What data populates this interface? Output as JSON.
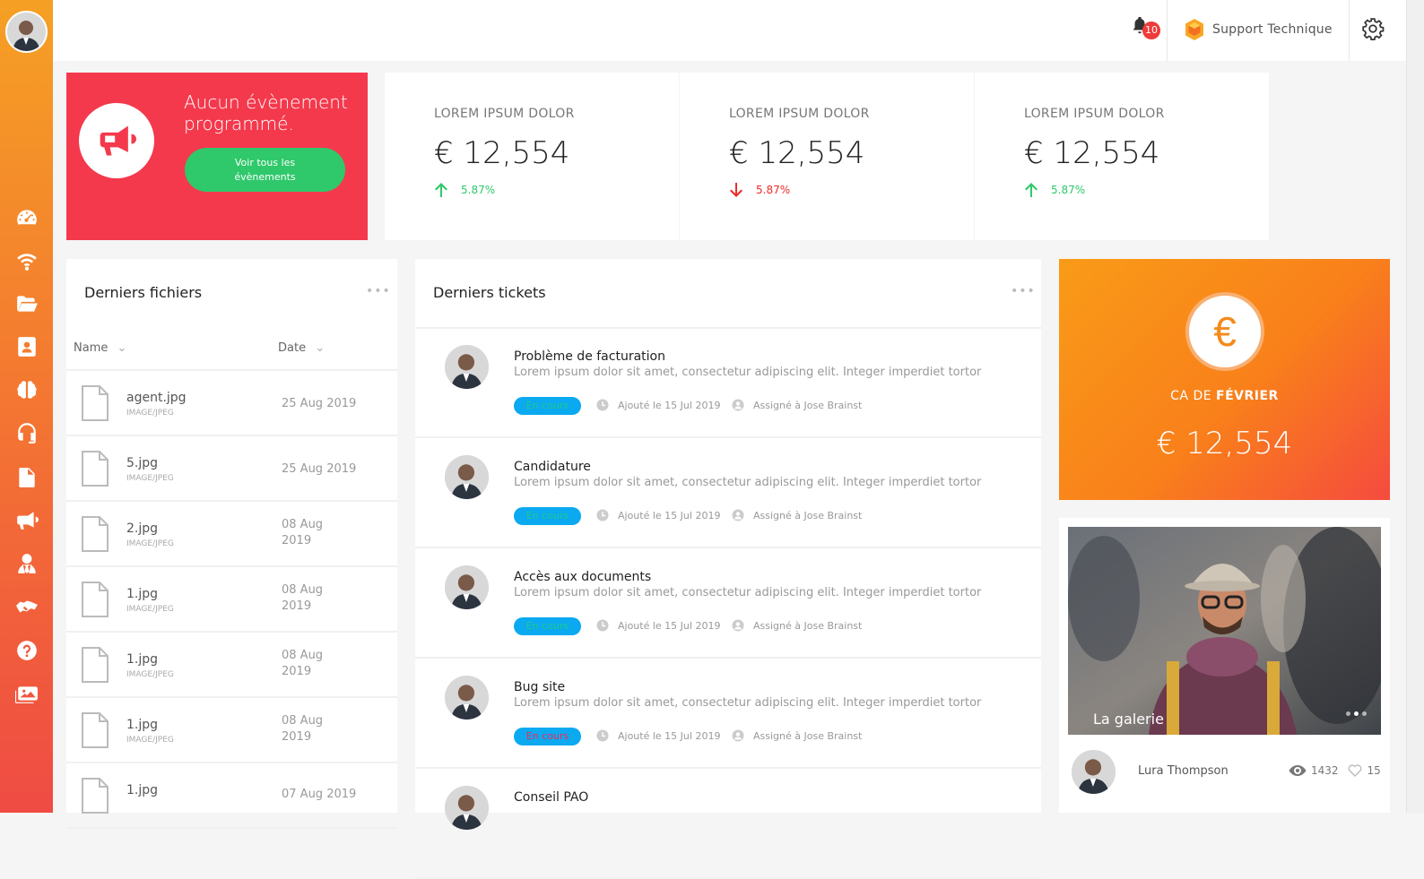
{
  "topbar": {
    "notifications_count": "10",
    "support_label": "Support Technique"
  },
  "event_card": {
    "title": "Aucun évènement programmé.",
    "button_label": "Voir tous les évènements"
  },
  "stats": [
    {
      "label": "LOREM IPSUM DOLOR",
      "value": "€ 12,554",
      "trend": "5.87%",
      "direction": "up",
      "color": "#2fc86b"
    },
    {
      "label": "LOREM IPSUM DOLOR",
      "value": "€ 12,554",
      "trend": "5.87%",
      "direction": "down",
      "color": "#ef2b2b"
    },
    {
      "label": "LOREM IPSUM DOLOR",
      "value": "€ 12,554",
      "trend": "5.87%",
      "direction": "up",
      "color": "#2fc86b"
    }
  ],
  "files": {
    "title": "Derniers fichiers",
    "more": "•••",
    "col_name": "Name",
    "col_date": "Date",
    "rows": [
      {
        "name": "agent.jpg",
        "type": "IMAGE/JPEG",
        "date": "25 Aug 2019"
      },
      {
        "name": "5.jpg",
        "type": "IMAGE/JPEG",
        "date": "25 Aug 2019"
      },
      {
        "name": "2.jpg",
        "type": "IMAGE/JPEG",
        "date": "08 Aug 2019"
      },
      {
        "name": "1.jpg",
        "type": "IMAGE/JPEG",
        "date": "08 Aug 2019"
      },
      {
        "name": "1.jpg",
        "type": "IMAGE/JPEG",
        "date": "08 Aug 2019"
      },
      {
        "name": "1.jpg",
        "type": "IMAGE/JPEG",
        "date": "08 Aug 2019"
      },
      {
        "name": "1.jpg",
        "type": "",
        "date": "07 Aug 2019"
      }
    ]
  },
  "tickets": {
    "title": "Derniers tickets",
    "more": "•••",
    "rows": [
      {
        "title": "Problème de facturation",
        "desc": "Lorem ipsum dolor sit amet, consectetur adipiscing elit. Integer imperdiet tortor",
        "status": "En cours",
        "added": "Ajouté le 15 Jul 2019",
        "assigned": "Assigné à Jose Brainst"
      },
      {
        "title": "Candidature",
        "desc": "Lorem ipsum dolor sit amet, consectetur adipiscing elit. Integer imperdiet tortor",
        "status": "En cours",
        "added": "Ajouté le 15 Jul 2019",
        "assigned": "Assigné à Jose Brainst"
      },
      {
        "title": "Accès aux documents",
        "desc": "Lorem ipsum dolor sit amet, consectetur adipiscing elit. Integer imperdiet tortor",
        "status": "En cours",
        "added": "Ajouté le 15 Jul 2019",
        "assigned": "Assigné à Jose Brainst"
      },
      {
        "title": "Bug site",
        "desc": "Lorem ipsum dolor sit amet, consectetur adipiscing elit. Integer imperdiet tortor",
        "status": "En cours",
        "added": "Ajouté le 15 Jul 2019",
        "assigned": "Assigné à Jose Brainst"
      },
      {
        "title": "Conseil PAO",
        "desc": "",
        "status": "",
        "added": "",
        "assigned": ""
      }
    ]
  },
  "revenue_card": {
    "symbol": "€",
    "label_prefix": "CA DE",
    "label_month": "FÉVRIER",
    "value": "€ 12,554"
  },
  "gallery": {
    "caption": "La galerie",
    "author": "Lura Thompson",
    "views": "1432",
    "likes": "15"
  },
  "sidebar_icons": [
    "dashboard-icon",
    "wifi-icon",
    "folder-icon",
    "contact-icon",
    "brain-icon",
    "headset-icon",
    "document-icon",
    "megaphone-icon",
    "user-tie-icon",
    "handshake-icon",
    "help-icon",
    "gallery-icon"
  ]
}
